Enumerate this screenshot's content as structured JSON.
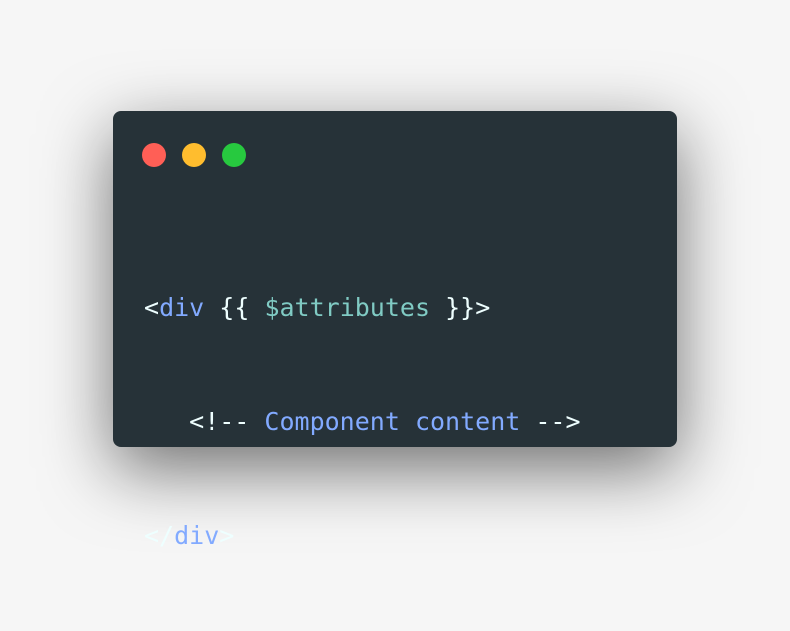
{
  "window": {
    "traffic_lights": [
      {
        "name": "close",
        "color": "#ff5f56"
      },
      {
        "name": "minimize",
        "color": "#ffbd2e"
      },
      {
        "name": "maximize",
        "color": "#27c93f"
      }
    ],
    "background_color": "#263238"
  },
  "code": {
    "line1": {
      "open": "<",
      "tag": "div",
      "sp1": " ",
      "brace_open": "{{",
      "sp2": " ",
      "var": "$attributes",
      "sp3": " ",
      "brace_close": "}}",
      "close": ">"
    },
    "line2": {
      "indent": "   ",
      "comment_open": "<!--",
      "comment_text": " Component content ",
      "comment_close": "-->"
    },
    "line3": {
      "open": "</",
      "tag": "div",
      "close": ">"
    }
  },
  "colors": {
    "punctuation": "#eeffff",
    "tag": "#82aaff",
    "variable": "#80cbc4"
  }
}
